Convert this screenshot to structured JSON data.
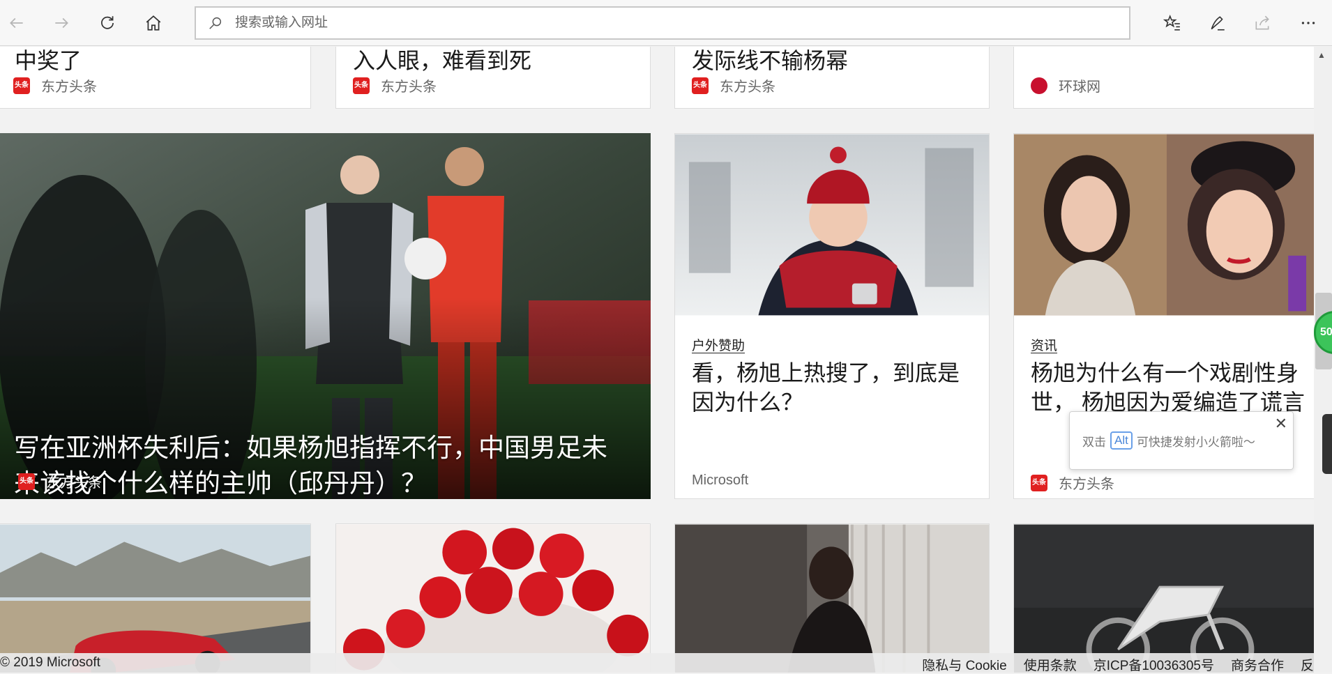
{
  "toolbar": {
    "address_placeholder": "搜索或输入网址"
  },
  "top_row": [
    {
      "title": "中奖了",
      "source": "东方头条",
      "logo_text": "头条"
    },
    {
      "title": "入人眼，难看到死",
      "source": "东方头条",
      "logo_text": "头条"
    },
    {
      "title": "发际线不输杨幂",
      "source": "东方头条",
      "logo_text": "头条"
    },
    {
      "title": "",
      "source": "环球网",
      "logo_text": ""
    }
  ],
  "hero": {
    "title": "写在亚洲杯失利后：如果杨旭指挥不行，中国男足未来该找个什么样的主帅（邱丹丹）？",
    "source": "东方头条",
    "logo_text": "头条"
  },
  "card_sponsored": {
    "tag": "户外赞助",
    "title": "看，杨旭上热搜了，到底是因为什么？",
    "source": "Microsoft"
  },
  "card_news": {
    "tag": "资讯",
    "title": "杨旭为什么有一个戏剧性身世， 杨旭因为爱编造了谎言",
    "source": "东方头条",
    "logo_text": "头条"
  },
  "tooltip": {
    "before": "双击",
    "key": "Alt",
    "after": "可快捷发射小火箭啦～",
    "close": "✕"
  },
  "float_ball": {
    "text": "50"
  },
  "footer": {
    "copyright": "© 2019 Microsoft",
    "links": [
      "隐私与 Cookie",
      "使用条款",
      "京ICP备10036305号",
      "商务合作",
      "反"
    ]
  }
}
